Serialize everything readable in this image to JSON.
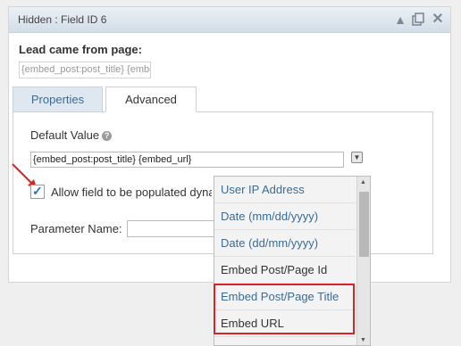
{
  "panel": {
    "title": "Hidden : Field ID 6",
    "icons": [
      "collapse-icon",
      "duplicate-icon",
      "close-icon"
    ]
  },
  "field": {
    "label": "Lead came from page:",
    "preview_value": "{embed_post:post_title} {embed_url}"
  },
  "tabs": [
    {
      "label": "Properties",
      "active": false
    },
    {
      "label": "Advanced",
      "active": true
    }
  ],
  "advanced": {
    "default_value_label": "Default Value",
    "help_glyph": "?",
    "default_value": "{embed_post:post_title} {embed_url}",
    "allow_populate_label": "Allow field to be populated dynamically",
    "allow_populate_checked": true,
    "parameter_name_label": "Parameter Name:",
    "parameter_name_value": ""
  },
  "merge_tags": {
    "items": [
      {
        "label": "User IP Address"
      },
      {
        "label": "Date (mm/dd/yyyy)"
      },
      {
        "label": "Date (dd/mm/yyyy)"
      },
      {
        "label": "Embed Post/Page Id"
      },
      {
        "label": "Embed Post/Page Title"
      },
      {
        "label": "Embed URL"
      }
    ],
    "highlighted": [
      "Embed Post/Page Title",
      "Embed URL"
    ]
  },
  "colors": {
    "accent": "#3a6c96",
    "annotation": "#d9252a"
  }
}
